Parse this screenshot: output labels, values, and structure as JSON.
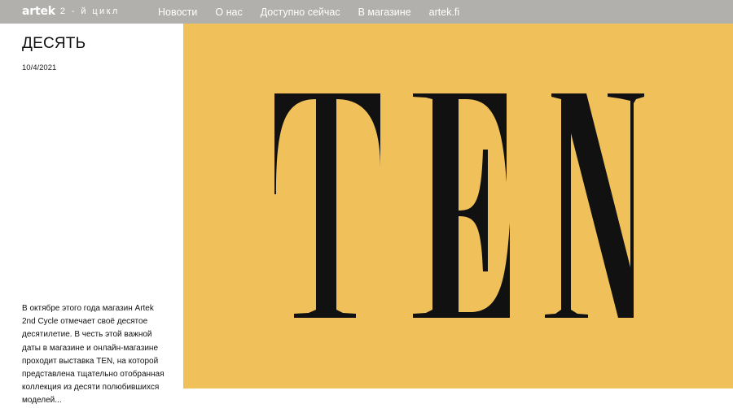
{
  "header": {
    "logo_word": "artek",
    "logo_tag": "2 - й цикл",
    "nav": [
      {
        "label": "Новости"
      },
      {
        "label": "О нас"
      },
      {
        "label": "Доступно сейчас"
      },
      {
        "label": "В магазине"
      },
      {
        "label": "artek.fi"
      }
    ]
  },
  "article": {
    "title": "ДЕСЯТЬ",
    "date": "10/4/2021",
    "excerpt": "В октябре этого года магазин Artek 2nd Cycle отмечает своё десятое десятилетие. В честь этой важной даты в магазине и онлайн-магазине проходит выставка TEN, на которой представлена тщательно отобранная коллекция из десяти полюбившихся моделей..."
  },
  "hero": {
    "text": "TEN",
    "background_color": "#f0c05a",
    "text_color": "#111111"
  },
  "colors": {
    "header_bg": "#b1b0ad",
    "header_text": "#ffffff"
  }
}
